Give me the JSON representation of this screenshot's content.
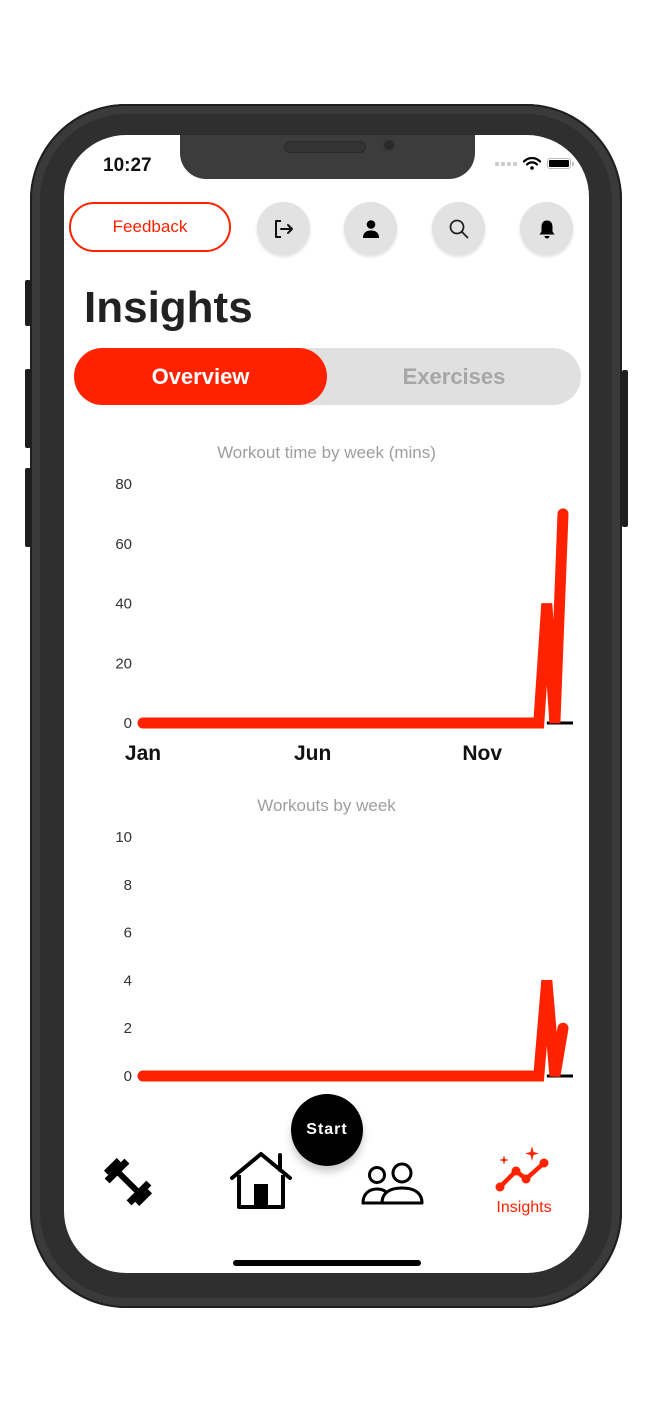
{
  "status_bar": {
    "time": "10:27"
  },
  "header": {
    "feedback_label": "Feedback",
    "icons": [
      "logout-icon",
      "profile-icon",
      "search-icon",
      "bell-icon"
    ]
  },
  "page": {
    "title": "Insights"
  },
  "tabs": [
    {
      "label": "Overview",
      "active": true
    },
    {
      "label": "Exercises",
      "active": false
    }
  ],
  "colors": {
    "accent": "#ff2200",
    "inactive_tab_bg": "#e0e0e0",
    "icon_button_bg": "#e2e2e2"
  },
  "chart_data": [
    {
      "type": "line",
      "title": "Workout time by week (mins)",
      "xlabel": "",
      "ylabel": "",
      "ylim": [
        0,
        80
      ],
      "yticks": [
        0,
        20,
        40,
        60,
        80
      ],
      "xticks": [
        {
          "label": "Jan",
          "week": 0
        },
        {
          "label": "Jun",
          "week": 21
        },
        {
          "label": "Nov",
          "week": 42
        }
      ],
      "grid": false,
      "series": [
        {
          "name": "Workout time",
          "color": "#ff2200",
          "values": [
            0,
            0,
            0,
            0,
            0,
            0,
            0,
            0,
            0,
            0,
            0,
            0,
            0,
            0,
            0,
            0,
            0,
            0,
            0,
            0,
            0,
            0,
            0,
            0,
            0,
            0,
            0,
            0,
            0,
            0,
            0,
            0,
            0,
            0,
            0,
            0,
            0,
            0,
            0,
            0,
            0,
            0,
            0,
            0,
            0,
            0,
            0,
            0,
            0,
            0,
            40,
            0,
            70
          ]
        }
      ]
    },
    {
      "type": "line",
      "title": "Workouts by week",
      "xlabel": "",
      "ylabel": "",
      "ylim": [
        0,
        10
      ],
      "yticks": [
        0,
        2,
        4,
        6,
        8,
        10
      ],
      "xticks": [],
      "grid": false,
      "series": [
        {
          "name": "Workouts",
          "color": "#ff2200",
          "values": [
            0,
            0,
            0,
            0,
            0,
            0,
            0,
            0,
            0,
            0,
            0,
            0,
            0,
            0,
            0,
            0,
            0,
            0,
            0,
            0,
            0,
            0,
            0,
            0,
            0,
            0,
            0,
            0,
            0,
            0,
            0,
            0,
            0,
            0,
            0,
            0,
            0,
            0,
            0,
            0,
            0,
            0,
            0,
            0,
            0,
            0,
            0,
            0,
            0,
            0,
            4,
            0,
            2
          ]
        }
      ]
    }
  ],
  "bottom_nav": {
    "start_label": "Start",
    "items": [
      {
        "icon": "dumbbell-icon",
        "label": ""
      },
      {
        "icon": "home-icon",
        "label": ""
      },
      {
        "icon": "people-icon",
        "label": ""
      },
      {
        "icon": "insights-icon",
        "label": "Insights",
        "active": true
      }
    ]
  }
}
